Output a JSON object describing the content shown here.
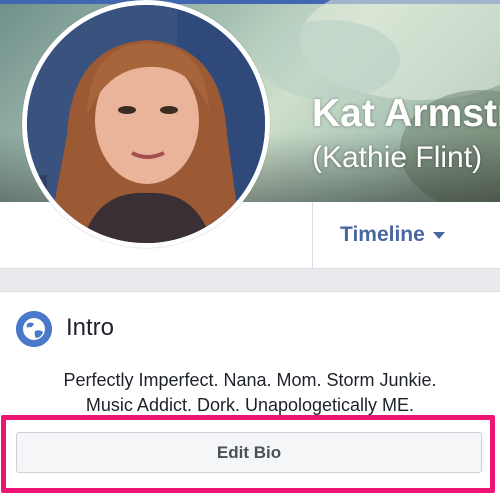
{
  "profile": {
    "name": "Kat Armstr",
    "alternate_name": "(Kathie Flint)"
  },
  "nav": {
    "timeline_label": "Timeline"
  },
  "intro": {
    "title": "Intro",
    "bio_lines": [
      "Perfectly Imperfect. Nana. Mom. Storm Junkie.",
      "Music Addict. Dork. Unapologetically ME."
    ],
    "edit_bio_label": "Edit Bio"
  },
  "colors": {
    "facebook_blue": "#4b67a1",
    "highlight": "#ee1474",
    "page_gray": "#e9ebee"
  },
  "icons": {
    "intro": "globe-icon",
    "timeline_dropdown": "caret-down-icon"
  }
}
